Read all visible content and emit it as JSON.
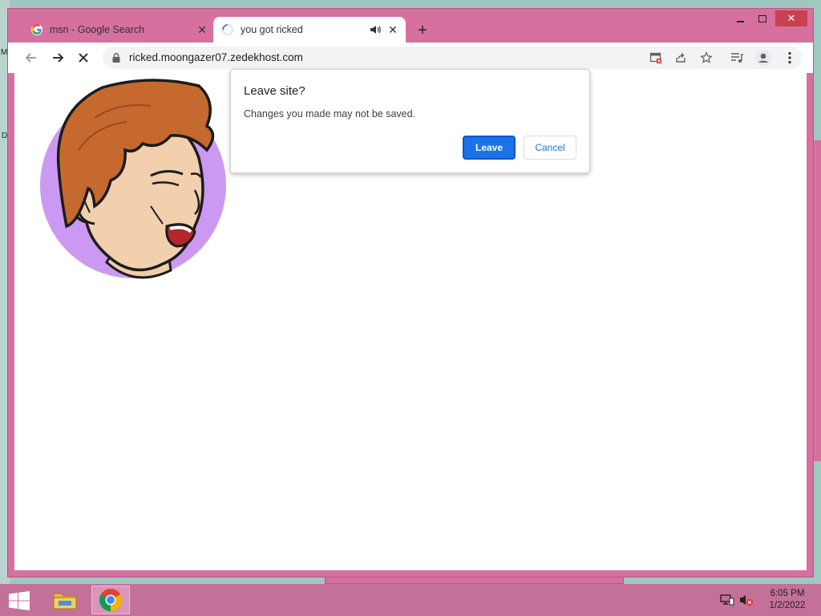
{
  "desktop": {
    "left_edge_label_1": "M",
    "left_edge_label_2": "D"
  },
  "browser": {
    "tabs": [
      {
        "title": "msn - Google Search",
        "favicon": "google-g-icon",
        "active": false
      },
      {
        "title": "you got ricked",
        "favicon": "loading-spinner-icon",
        "active": true,
        "audio": "speaker-icon"
      }
    ],
    "new_tab_icon": "plus-icon",
    "window_controls": [
      "minimize-icon",
      "maximize-icon",
      "close-icon"
    ],
    "toolbar": {
      "back_icon": "arrow-left-icon",
      "forward_icon": "arrow-right-icon",
      "stop_icon": "x-icon",
      "url": "ricked.moongazer07.zedekhost.com",
      "right_icons": [
        "popup-blocked-icon",
        "share-icon",
        "star-icon",
        "media-queue-icon",
        "profile-icon",
        "kebab-menu-icon"
      ]
    },
    "page": {
      "image": "cartoon-face-illustration"
    },
    "dialog": {
      "title": "Leave site?",
      "message": "Changes you made may not be saved.",
      "leave_label": "Leave",
      "cancel_label": "Cancel"
    }
  },
  "taskbar": {
    "start_icon": "windows-logo-icon",
    "apps": [
      "file-explorer-icon",
      "chrome-icon"
    ],
    "tray_icons": [
      "network-icon",
      "volume-muted-icon"
    ],
    "time": "6:05 PM",
    "date": "1/2/2022"
  },
  "colors": {
    "window_frame": "#d6709f",
    "taskbar": "#c4719a",
    "accent_blue": "#1a73e8",
    "desktop": "#9fc8c0",
    "close_button": "#c7424e"
  }
}
